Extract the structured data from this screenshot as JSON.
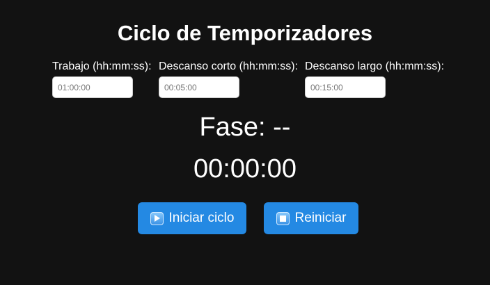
{
  "title": "Ciclo de Temporizadores",
  "fields": [
    {
      "label": "Trabajo (hh:mm:ss):",
      "value": "",
      "placeholder": "01:00:00"
    },
    {
      "label": "Descanso corto (hh:mm:ss):",
      "value": "",
      "placeholder": "00:05:00"
    },
    {
      "label": "Descanso largo (hh:mm:ss):",
      "value": "",
      "placeholder": "00:15:00"
    }
  ],
  "phase": "Fase: --",
  "time": "00:00:00",
  "buttons": {
    "start_label": "Iniciar ciclo",
    "start_icon": "play-icon",
    "reset_label": "Reiniciar",
    "reset_icon": "stop-icon"
  },
  "colors": {
    "background": "#121212",
    "button": "#2489e3",
    "text": "#ffffff"
  }
}
